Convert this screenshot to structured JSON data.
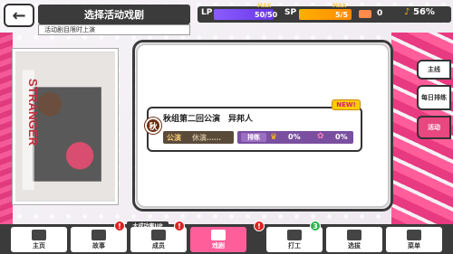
{
  "header": {
    "back_icon": "back-arrow-icon",
    "title": "选择活动戏剧",
    "subtitle": "活动剧目限时上演"
  },
  "status": {
    "lp_label": "LP",
    "lp_max_label": "MAX",
    "lp_value": "50/50",
    "lp_fill": 1.0,
    "sp_label": "SP",
    "sp_max_label": "MAX",
    "sp_value": "5/5",
    "sp_fill": 1.0,
    "ticket_count": "0",
    "battery": "56%"
  },
  "card": {
    "badge": "秋",
    "title": "秋组第二回公演　异邦人",
    "new_tag": "NEW!",
    "perform_label": "公演",
    "perform_status": "休演……",
    "practice_label": "排练",
    "crown_value": "0%",
    "flower_value": "0%"
  },
  "right_tabs": [
    {
      "label": "主线",
      "active": false
    },
    {
      "label": "每日排练",
      "active": false
    },
    {
      "label": "活动",
      "active": true
    }
  ],
  "nav": {
    "items": [
      {
        "label": "主页",
        "icon": "home-icon",
        "active": false
      },
      {
        "label": "故事",
        "icon": "book-icon",
        "active": false,
        "badge": "!"
      },
      {
        "label": "成员",
        "icon": "members-icon",
        "active": false,
        "badge": "!"
      },
      {
        "label": "戏剧",
        "icon": "theater-icon",
        "active": true,
        "badge": "!"
      },
      {
        "label": "打工",
        "icon": "coins-icon",
        "active": false,
        "badge": "!"
      },
      {
        "label": "选拔",
        "icon": "star-card-icon",
        "active": false,
        "badge": "3"
      },
      {
        "label": "菜单",
        "icon": "grid-menu-icon",
        "active": false
      }
    ],
    "up_banner": "大成功率UP"
  },
  "poster": {
    "text": "STRANGER"
  },
  "colors": {
    "accent": "#ff5e9a",
    "dark": "#3b3b3b",
    "lp": "#7c4dff",
    "sp": "#ff9a00"
  }
}
